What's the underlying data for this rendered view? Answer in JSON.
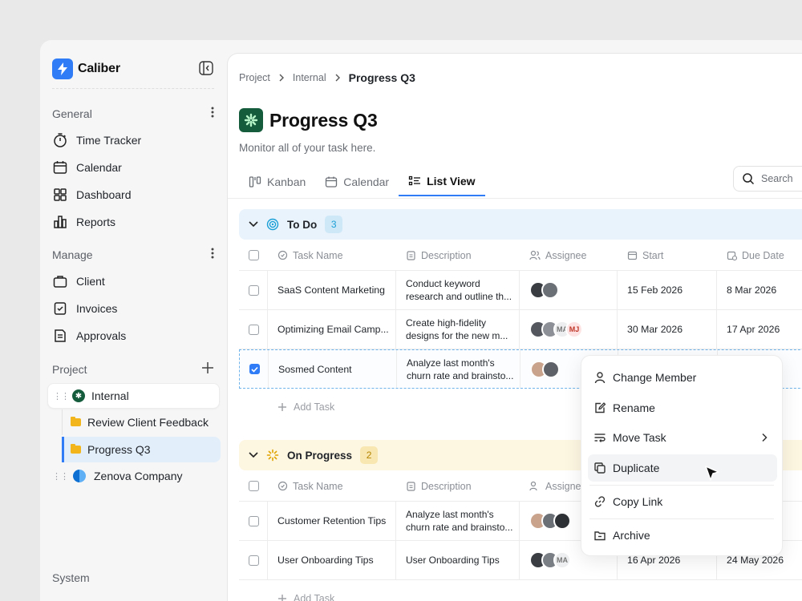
{
  "app": {
    "name": "Caliber"
  },
  "sidebar": {
    "general": {
      "label": "General",
      "items": [
        {
          "label": "Time Tracker",
          "icon": "stopwatch-icon"
        },
        {
          "label": "Calendar",
          "icon": "calendar-icon"
        },
        {
          "label": "Dashboard",
          "icon": "grid-icon"
        },
        {
          "label": "Reports",
          "icon": "bar-chart-icon"
        }
      ]
    },
    "manage": {
      "label": "Manage",
      "items": [
        {
          "label": "Client",
          "icon": "briefcase-icon"
        },
        {
          "label": "Invoices",
          "icon": "invoice-icon"
        },
        {
          "label": "Approvals",
          "icon": "document-icon"
        }
      ]
    },
    "project": {
      "label": "Project",
      "internal": "Internal",
      "subitems": [
        "Review Client Feedback",
        "Progress Q3"
      ],
      "zenova": "Zenova Company"
    },
    "system": {
      "label": "System"
    }
  },
  "breadcrumb": [
    "Project",
    "Internal",
    "Progress Q3"
  ],
  "page": {
    "title": "Progress Q3",
    "subtitle": "Monitor all of your task here."
  },
  "tabs": [
    "Kanban",
    "Calendar",
    "List View"
  ],
  "search": {
    "placeholder": "Search"
  },
  "columns": [
    "Task Name",
    "Description",
    "Assignee",
    "Start",
    "Due Date"
  ],
  "groups": [
    {
      "name": "To Do",
      "count": "3",
      "color": "#1a9fd6",
      "rows": [
        {
          "task": "SaaS Content Marketing",
          "desc1": "Conduct keyword",
          "desc2": "research and outline th...",
          "start": "15 Feb 2026",
          "due": "8 Mar 2026",
          "checked": false
        },
        {
          "task": "Optimizing Email Camp...",
          "desc1": "Create high-fidelity",
          "desc2": "designs for the new m...",
          "start": "30 Mar 2026",
          "due": "17 Apr 2026",
          "checked": false,
          "badge1": "MA",
          "badge2": "MJ"
        },
        {
          "task": "Sosmed Content",
          "desc1": "Analyze last month's",
          "desc2": "churn rate and brainsto...",
          "start": "",
          "due": "",
          "checked": true
        }
      ]
    },
    {
      "name": "On Progress",
      "count": "2",
      "color": "#e0a400",
      "rows": [
        {
          "task": "Customer Retention Tips",
          "desc1": "Analyze last month's",
          "desc2": "churn rate and brainsto...",
          "start": "",
          "due": "",
          "checked": false
        },
        {
          "task": "User Onboarding Tips",
          "desc1": "User Onboarding Tips",
          "desc2": "",
          "start": "16 Apr 2026",
          "due": "24 May 2026",
          "checked": false,
          "badge1": "MA"
        }
      ]
    }
  ],
  "add_task": "Add Task",
  "context_menu": [
    "Change Member",
    "Rename",
    "Move Task",
    "Duplicate",
    "Copy Link",
    "Archive"
  ]
}
